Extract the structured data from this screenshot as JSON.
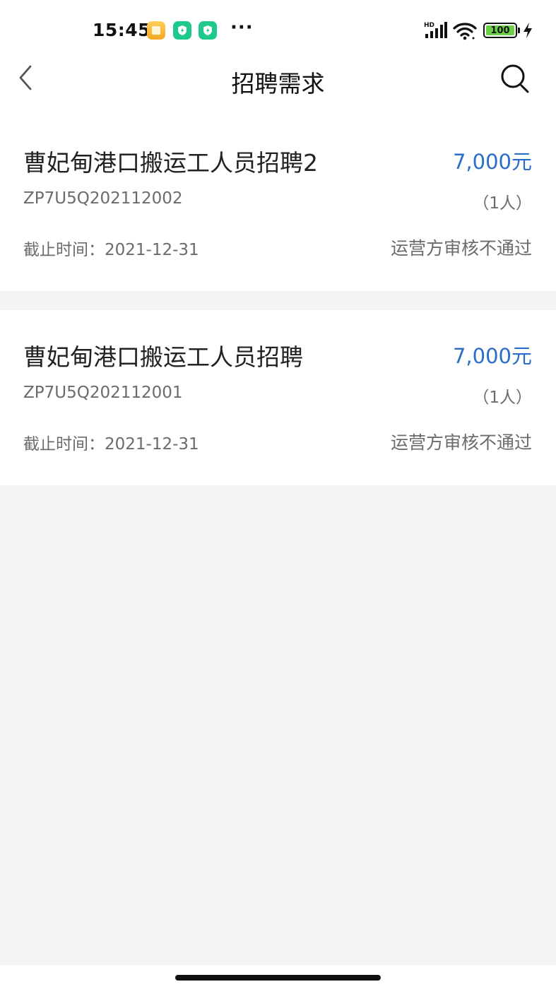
{
  "status_bar": {
    "time": "15:45",
    "more": "···",
    "battery": "100",
    "icons": [
      "notes-app-icon",
      "shield-app-icon",
      "shield-app-icon",
      "hd-signal-icon",
      "wifi-icon",
      "battery-icon",
      "charging-bolt-icon"
    ]
  },
  "header": {
    "title": "招聘需求",
    "back_icon": "chevron-left-icon",
    "search_icon": "search-icon"
  },
  "listings": [
    {
      "title": "曹妃甸港口搬运工人员招聘2",
      "salary": "7,000元",
      "code": "ZP7U5Q202112002",
      "count": "（1人）",
      "deadline": "截止时间：2021-12-31",
      "status": "运营方审核不通过"
    },
    {
      "title": "曹妃甸港口搬运工人员招聘",
      "salary": "7,000元",
      "code": "ZP7U5Q202112001",
      "count": "（1人）",
      "deadline": "截止时间：2021-12-31",
      "status": "运营方审核不通过"
    }
  ],
  "colors": {
    "accent": "#2b6ec9",
    "text_primary": "#222222",
    "text_secondary": "#6b6b6b",
    "background": "#f4f4f4",
    "card": "#ffffff"
  }
}
